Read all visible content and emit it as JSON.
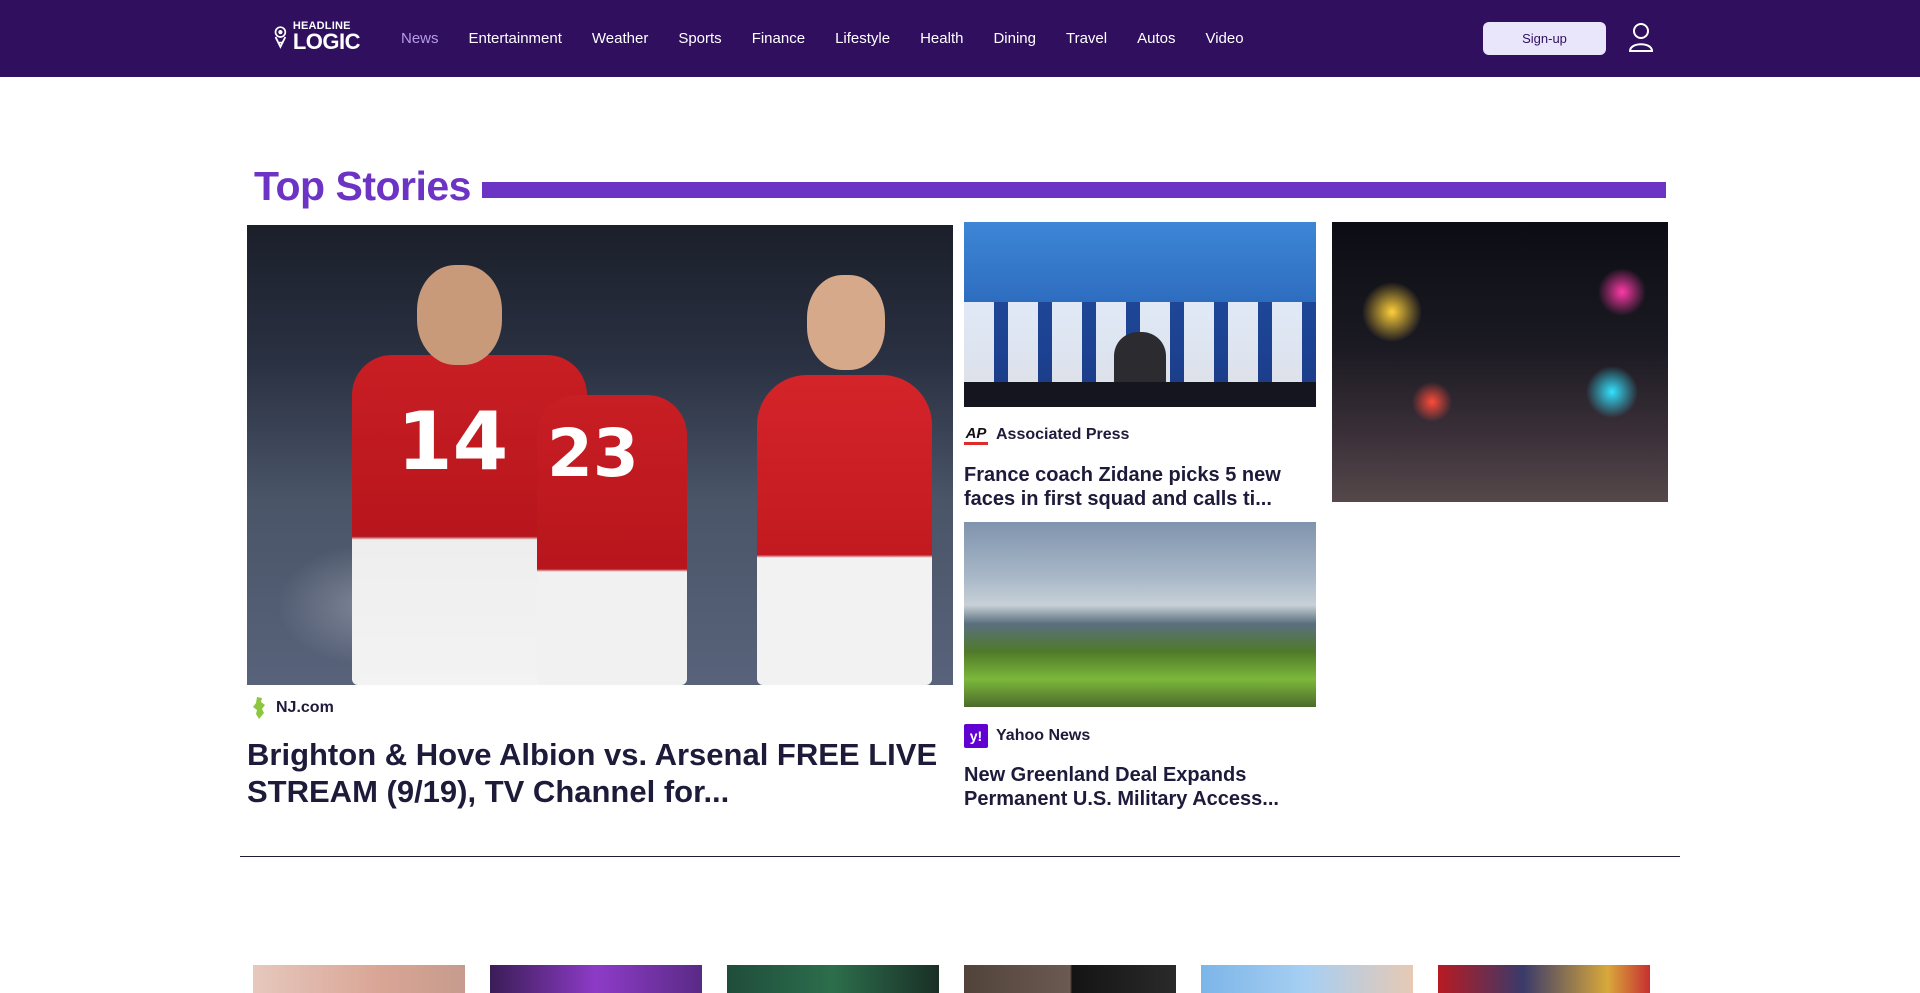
{
  "header": {
    "logo": {
      "top": "HEADLINE",
      "bottom": "LOGIC"
    },
    "nav": [
      {
        "label": "News",
        "active": true
      },
      {
        "label": "Entertainment"
      },
      {
        "label": "Weather"
      },
      {
        "label": "Sports"
      },
      {
        "label": "Finance"
      },
      {
        "label": "Lifestyle"
      },
      {
        "label": "Health"
      },
      {
        "label": "Dining"
      },
      {
        "label": "Travel"
      },
      {
        "label": "Autos"
      },
      {
        "label": "Video"
      }
    ],
    "signup_label": "Sign-up",
    "colors": {
      "background": "#2f0f5e",
      "active_nav": "#b59be6"
    }
  },
  "top_stories": {
    "title": "Top Stories",
    "accent": "#6c33c4",
    "main": {
      "source": "NJ.com",
      "headline": "Brighton & Hove Albion vs. Arsenal FREE LIVE STREAM (9/19), TV Channel for..."
    },
    "story_2": {
      "source": "Associated Press",
      "source_logo": "AP",
      "headline": "France coach Zidane picks 5 new faces in first squad and calls ti..."
    },
    "story_3": {
      "source": "Yahoo News",
      "source_logo": "y!",
      "headline": "New Greenland Deal Expands Permanent U.S. Military Access..."
    }
  }
}
